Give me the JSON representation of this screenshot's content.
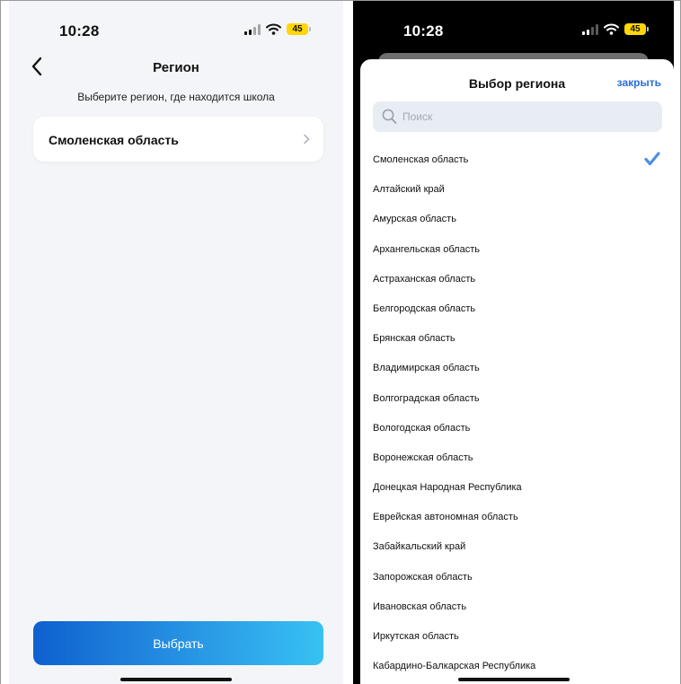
{
  "left_screen": {
    "status": {
      "time": "10:28",
      "battery": "45"
    },
    "nav": {
      "title": "Регион"
    },
    "hint": "Выберите регион, где находится школа",
    "selected_region": "Смоленская область",
    "select_button": "Выбрать"
  },
  "right_screen": {
    "status": {
      "time": "10:28",
      "battery": "45"
    },
    "sheet": {
      "title": "Выбор региона",
      "close_label": "закрыть",
      "search_placeholder": "Поиск"
    },
    "regions": [
      {
        "name": "Смоленская область",
        "selected": true
      },
      {
        "name": "Алтайский край",
        "selected": false
      },
      {
        "name": "Амурская область",
        "selected": false
      },
      {
        "name": "Архангельская область",
        "selected": false
      },
      {
        "name": "Астраханская область",
        "selected": false
      },
      {
        "name": "Белгородская область",
        "selected": false
      },
      {
        "name": "Брянская область",
        "selected": false
      },
      {
        "name": "Владимирская область",
        "selected": false
      },
      {
        "name": "Волгоградская область",
        "selected": false
      },
      {
        "name": "Вологодская область",
        "selected": false
      },
      {
        "name": "Воронежская область",
        "selected": false
      },
      {
        "name": "Донецкая Народная Республика",
        "selected": false
      },
      {
        "name": "Еврейская автономная область",
        "selected": false
      },
      {
        "name": "Забайкальский край",
        "selected": false
      },
      {
        "name": "Запорожская область",
        "selected": false
      },
      {
        "name": "Ивановская область",
        "selected": false
      },
      {
        "name": "Иркутская область",
        "selected": false
      },
      {
        "name": "Кабардино-Балкарская Республика",
        "selected": false
      }
    ]
  },
  "colors": {
    "accent": "#2a6fd6",
    "button_gradient_start": "#0f60cf",
    "button_gradient_end": "#37c2f3",
    "battery": "#ffd60a",
    "check": "#4a90e2",
    "left_background": "#f4f5f8"
  },
  "icons": {
    "back": "chevron-left-icon",
    "card_chevron": "chevron-right-icon",
    "search": "search-icon",
    "selected": "checkmark-icon",
    "signal": "cellular-signal-icon",
    "wifi": "wifi-icon",
    "battery": "battery-icon"
  }
}
